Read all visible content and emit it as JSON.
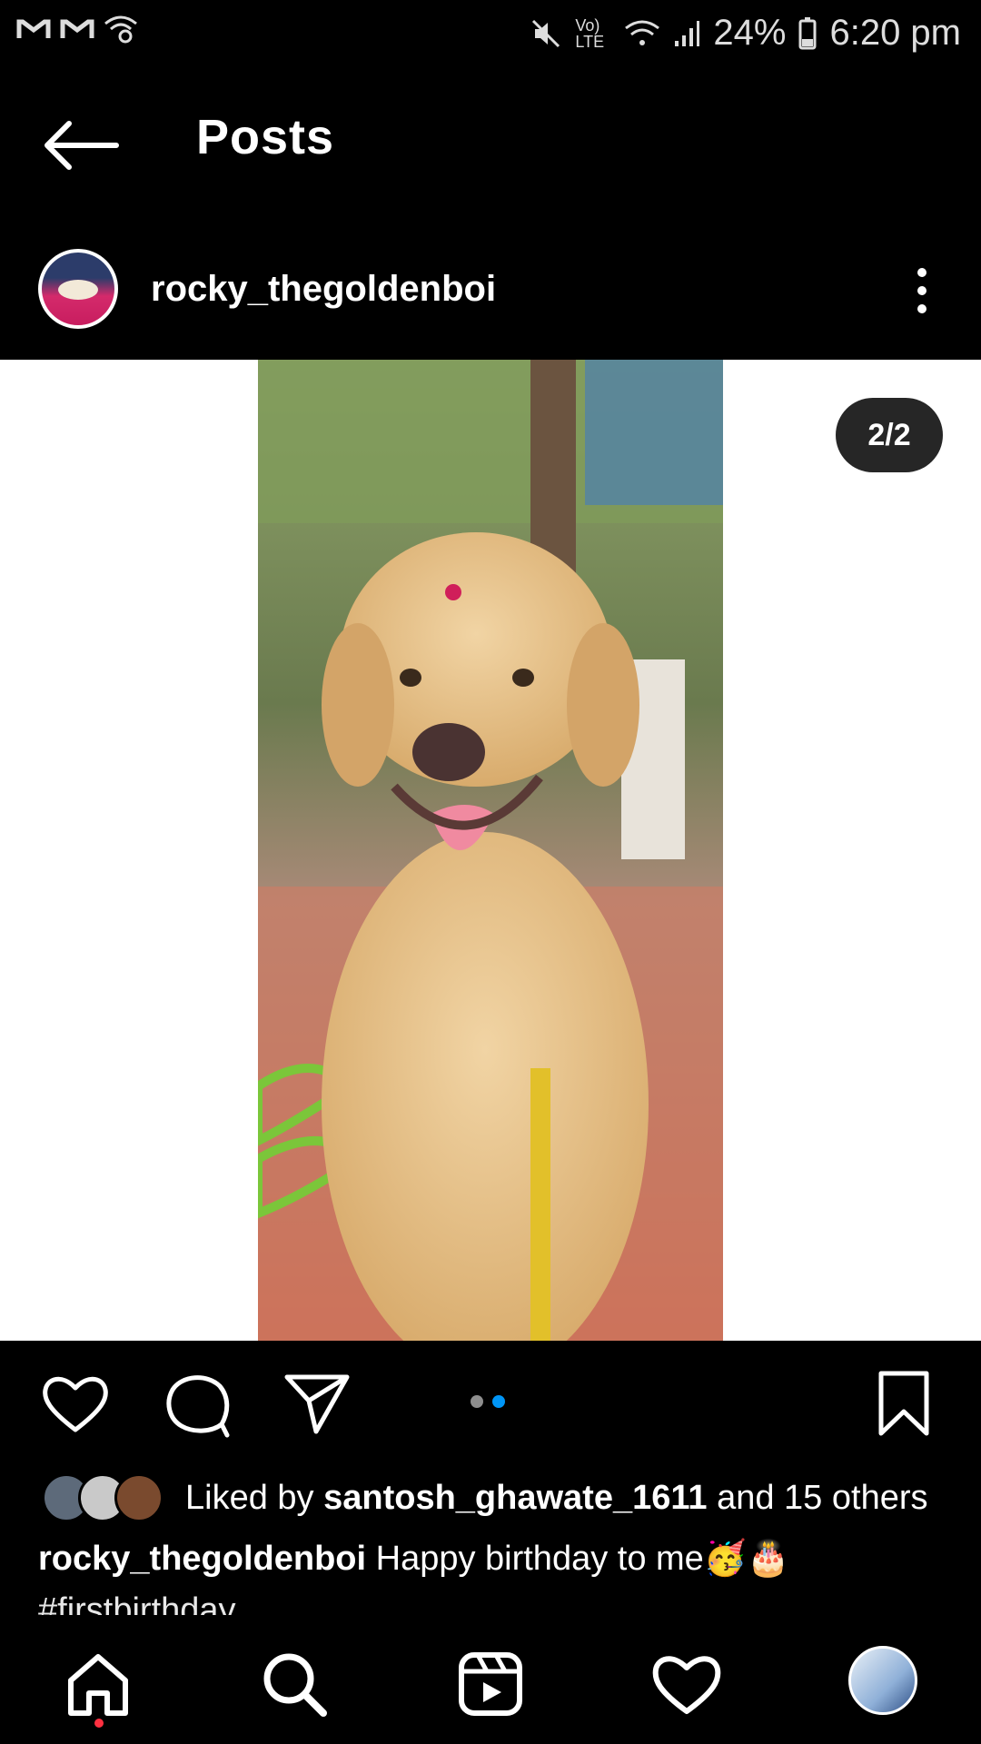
{
  "status_bar": {
    "battery": "24%",
    "time": "6:20 pm",
    "network_label": "Vo) LTE"
  },
  "header": {
    "title": "Posts"
  },
  "post": {
    "username": "rocky_thegoldenboi",
    "counter": "2/2",
    "carousel": {
      "count": 2,
      "active_index": 1
    }
  },
  "likes": {
    "prefix": "Liked by ",
    "user": "santosh_ghawate_1611",
    "suffix": " and 15 others"
  },
  "caption": {
    "username": "rocky_thegoldenboi",
    "text": " Happy birthday to me🥳🎂",
    "hashtag": "#firstbirthday"
  },
  "nav": {
    "items": [
      "home-icon",
      "search-icon",
      "reels-icon",
      "activity-icon",
      "profile-avatar"
    ]
  },
  "colors": {
    "accent": "#0095f6",
    "notification": "#ff3040",
    "counter_bg": "#262626"
  }
}
